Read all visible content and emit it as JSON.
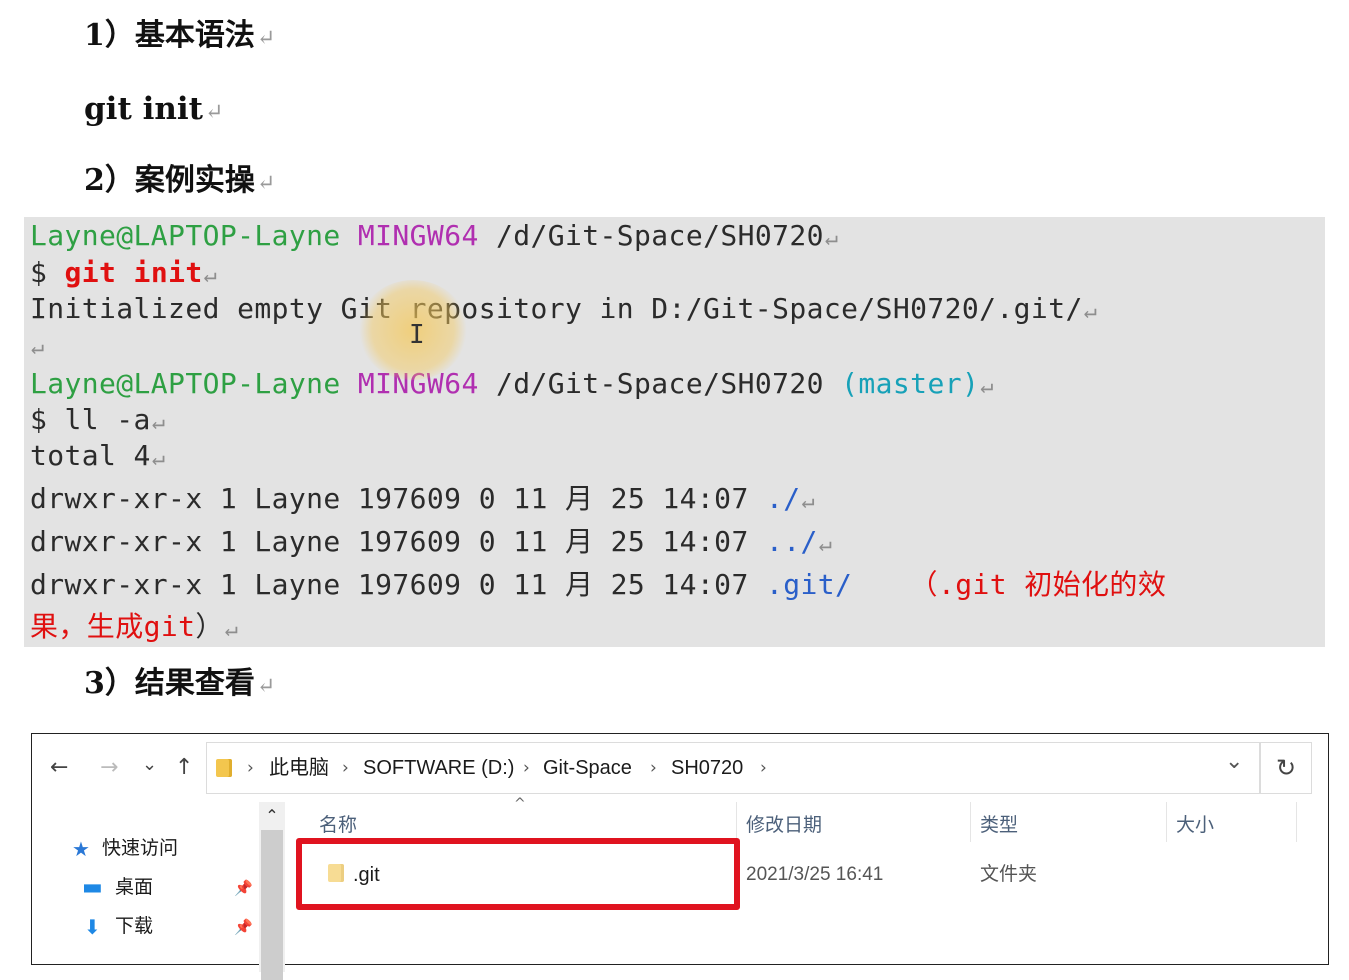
{
  "doc": {
    "heading_1": "1）基本语法",
    "command": "git init",
    "heading_2": "2）案例实操",
    "heading_3": "3）结果查看",
    "return_mark": "↵"
  },
  "terminal": {
    "line1": {
      "user": "Layne@LAPTOP-Layne",
      "shell": "MINGW64",
      "path": "/d/Git-Space/SH0720"
    },
    "line2": {
      "prompt": "$",
      "cmd": "git init"
    },
    "line3": "Initialized empty Git repository in D:/Git-Space/SH0720/.git/",
    "line5": {
      "user": "Layne@LAPTOP-Layne",
      "shell": "MINGW64",
      "path": "/d/Git-Space/SH0720",
      "branch": "(master)"
    },
    "line6": {
      "prompt": "$",
      "cmd": "ll -a"
    },
    "line7": "total 4",
    "entries": [
      {
        "perm": "drwxr-xr-x 1 Layne 197609 0 11 月 25 14:07",
        "name": "./"
      },
      {
        "perm": "drwxr-xr-x 1 Layne 197609 0 11 月 25 14:07",
        "name": "../"
      },
      {
        "perm": "drwxr-xr-x 1 Layne 197609 0 11 月 25 14:07",
        "name": ".git/"
      }
    ],
    "note_open": "（",
    "note_git": ".git",
    "note_text_1": " 初始化的效",
    "note_text_2": "果，生成",
    "note_git_2": "git",
    "note_close": "）",
    "cursor_glyph": "I"
  },
  "explorer": {
    "nav": {
      "back": "←",
      "forward": "→",
      "recent": "⌄",
      "up": "↑"
    },
    "breadcrumb": [
      "此电脑",
      "SOFTWARE (D:)",
      "Git-Space",
      "SH0720"
    ],
    "crumb_sep": "›",
    "dropdown": "⌄",
    "refresh": "↻",
    "sidebar": [
      {
        "label": "快速访问",
        "icon": "star-icon",
        "glyph": "★",
        "color": "#2a78d6"
      },
      {
        "label": "桌面",
        "icon": "desktop-icon",
        "glyph": "▬",
        "color": "#1e88e5"
      },
      {
        "label": "下载",
        "icon": "download-icon",
        "glyph": "⬇",
        "color": "#1e88e5"
      }
    ],
    "pin_glyph": "📌",
    "scroll_up": "⌃",
    "sort_arrow": "^",
    "columns": {
      "name": "名称",
      "modified": "修改日期",
      "type": "类型",
      "size": "大小"
    },
    "rows": [
      {
        "name": ".git",
        "modified": "2021/3/25 16:41",
        "type": "文件夹",
        "size": ""
      }
    ],
    "highlight_color": "#e0131f"
  }
}
